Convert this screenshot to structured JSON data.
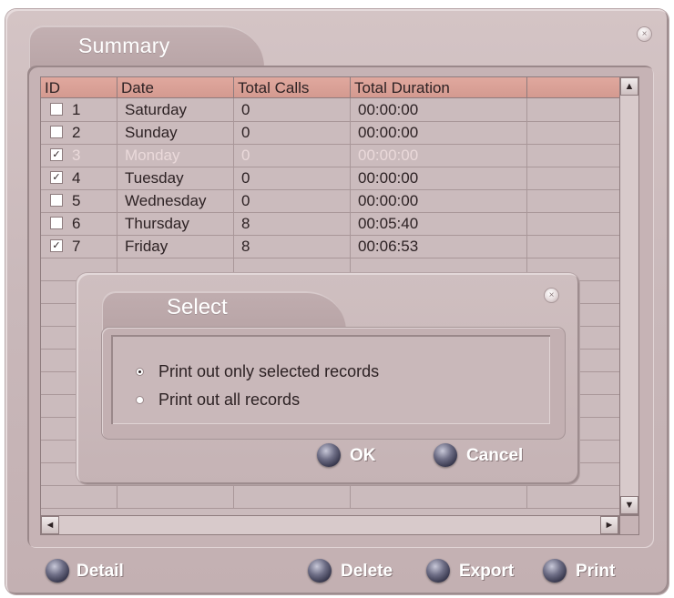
{
  "window": {
    "title": "Summary",
    "close_icon": "close-icon"
  },
  "table": {
    "headers": [
      "ID",
      "Date",
      "Total Calls",
      "Total Duration",
      ""
    ],
    "rows": [
      {
        "checked": false,
        "id": "1",
        "date": "Saturday",
        "calls": "0",
        "duration": "00:00:00",
        "highlight": false
      },
      {
        "checked": false,
        "id": "2",
        "date": "Sunday",
        "calls": "0",
        "duration": "00:00:00",
        "highlight": false
      },
      {
        "checked": true,
        "id": "3",
        "date": "Monday",
        "calls": "0",
        "duration": "00:00:00",
        "highlight": true
      },
      {
        "checked": true,
        "id": "4",
        "date": "Tuesday",
        "calls": "0",
        "duration": "00:00:00",
        "highlight": false
      },
      {
        "checked": false,
        "id": "5",
        "date": "Wednesday",
        "calls": "0",
        "duration": "00:00:00",
        "highlight": false
      },
      {
        "checked": false,
        "id": "6",
        "date": "Thursday",
        "calls": "8",
        "duration": "00:05:40",
        "highlight": false
      },
      {
        "checked": true,
        "id": "7",
        "date": "Friday",
        "calls": "8",
        "duration": "00:06:53",
        "highlight": false
      }
    ],
    "empty_rows": 11
  },
  "scrollbars": {
    "up": "▲",
    "down": "▼",
    "left": "◄",
    "right": "►"
  },
  "dialog": {
    "title": "Select",
    "options": [
      {
        "label": "Print out only selected records",
        "selected": true
      },
      {
        "label": "Print out all records",
        "selected": false
      }
    ],
    "ok_label": "OK",
    "cancel_label": "Cancel"
  },
  "footer": {
    "detail_label": "Detail",
    "delete_label": "Delete",
    "export_label": "Export",
    "print_label": "Print"
  },
  "colors": {
    "window_bg": "#c9b8ba",
    "header_bg": "#d89e94",
    "orb": "#3a3a52",
    "title_text": "#ffffff"
  }
}
